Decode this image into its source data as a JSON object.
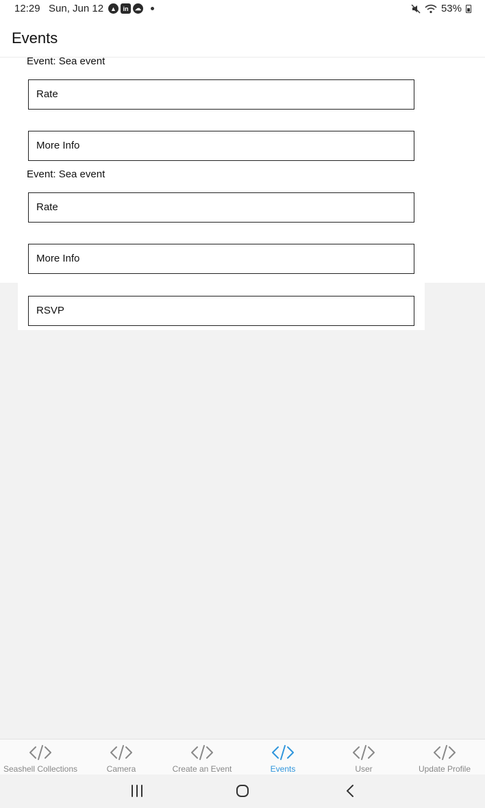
{
  "status_bar": {
    "time": "12:29",
    "date": "Sun, Jun 12",
    "notification_icons": [
      "app-a-icon",
      "linkedin-icon",
      "cloud-icon"
    ],
    "battery_text": "53%"
  },
  "header": {
    "title": "Events"
  },
  "events": [
    {
      "label": "Event: Sea event",
      "rate_label": "Rate",
      "more_info_label": "More Info"
    },
    {
      "label": "Event: Sea event",
      "rate_label": "Rate",
      "more_info_label": "More Info",
      "rsvp_label": "RSVP"
    }
  ],
  "tabs": [
    {
      "label": "Seashell Collections",
      "active": false
    },
    {
      "label": "Camera",
      "active": false
    },
    {
      "label": "Create an Event",
      "active": false
    },
    {
      "label": "Events",
      "active": true
    },
    {
      "label": "User",
      "active": false
    },
    {
      "label": "Update Profile",
      "active": false
    }
  ],
  "colors": {
    "active_tab": "#2f95dc",
    "inactive_tab": "#888888"
  }
}
